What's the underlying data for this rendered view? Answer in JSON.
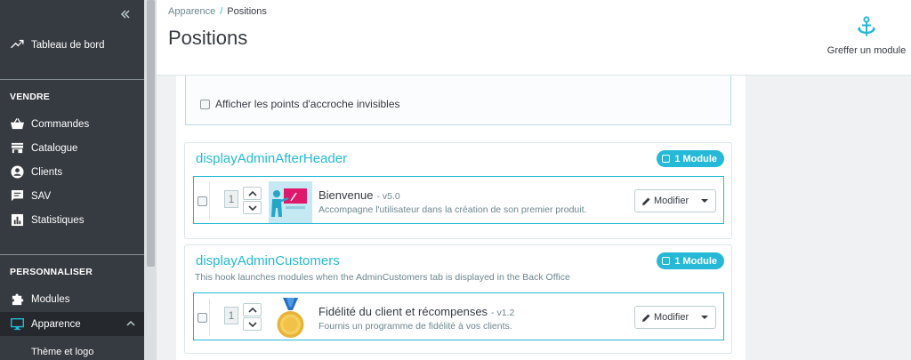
{
  "sidebar": {
    "collapse_icon": "double-chevron-left-icon",
    "dashboard_label": "Tableau de bord",
    "section_sell": "VENDRE",
    "sell_items": [
      {
        "label": "Commandes",
        "icon": "basket-icon"
      },
      {
        "label": "Catalogue",
        "icon": "store-icon"
      },
      {
        "label": "Clients",
        "icon": "user-circle-icon"
      },
      {
        "label": "SAV",
        "icon": "chat-icon"
      },
      {
        "label": "Statistiques",
        "icon": "bar-chart-icon"
      }
    ],
    "section_customize": "PERSONNALISER",
    "modules_label": "Modules",
    "appearance_label": "Apparence",
    "theme_label": "Thème et logo",
    "accent_color": "#25b9d7"
  },
  "header": {
    "breadcrumb_parent": "Apparence",
    "breadcrumb_sep": "/",
    "breadcrumb_current": "Positions",
    "title": "Positions",
    "action_label": "Greffer un module",
    "action_icon": "anchor-icon"
  },
  "toggle": {
    "label": "Afficher les points d'accroche invisibles"
  },
  "hooks": [
    {
      "name": "displayAdminAfterHeader",
      "description": "",
      "badge": "1 Module",
      "module": {
        "position": "1",
        "name": "Bienvenue",
        "version": "- v5.0",
        "description": "Accompagne l'utilisateur dans la création de son premier produit.",
        "action": "Modifier"
      }
    },
    {
      "name": "displayAdminCustomers",
      "description": "This hook launches modules when the AdminCustomers tab is displayed in the Back Office",
      "badge": "1 Module",
      "module": {
        "position": "1",
        "name": "Fidélité du client et récompenses",
        "version": "- v1.2",
        "description": "Fournis un programme de fidélité à vos clients.",
        "action": "Modifier"
      }
    }
  ]
}
